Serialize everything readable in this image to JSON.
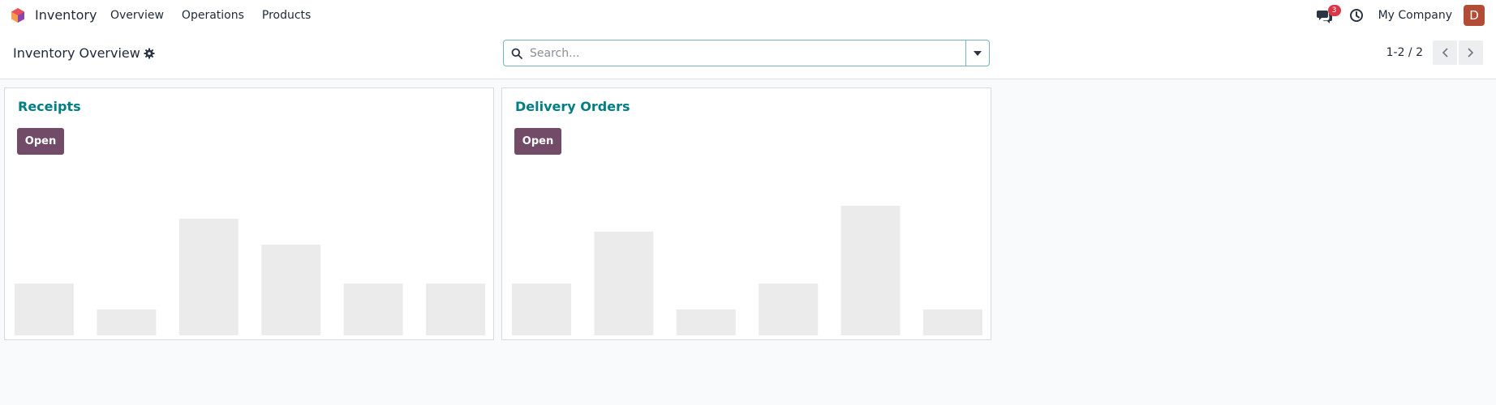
{
  "nav": {
    "app_name": "Inventory",
    "menu": [
      "Overview",
      "Operations",
      "Products"
    ],
    "messages_count": "3",
    "company": "My Company",
    "avatar_initial": "D"
  },
  "control": {
    "breadcrumb": "Inventory Overview",
    "search_placeholder": "Search...",
    "pager": "1-2 / 2"
  },
  "colors": {
    "brand": "#714b67",
    "accent": "#017e84",
    "badge": "#dc3545",
    "avatar": "#b24c35",
    "bar": "#ebebeb"
  },
  "cards": [
    {
      "title": "Receipts",
      "button": "Open"
    },
    {
      "title": "Delivery Orders",
      "button": "Open"
    }
  ],
  "chart_data": [
    {
      "type": "bar",
      "categories": [
        "",
        "",
        "",
        "",
        "",
        ""
      ],
      "values": [
        4,
        2,
        9,
        7,
        4,
        4
      ],
      "ylim": [
        0,
        10
      ]
    },
    {
      "type": "bar",
      "categories": [
        "",
        "",
        "",
        "",
        "",
        ""
      ],
      "values": [
        4,
        8,
        2,
        4,
        10,
        2
      ],
      "ylim": [
        0,
        10
      ]
    }
  ]
}
